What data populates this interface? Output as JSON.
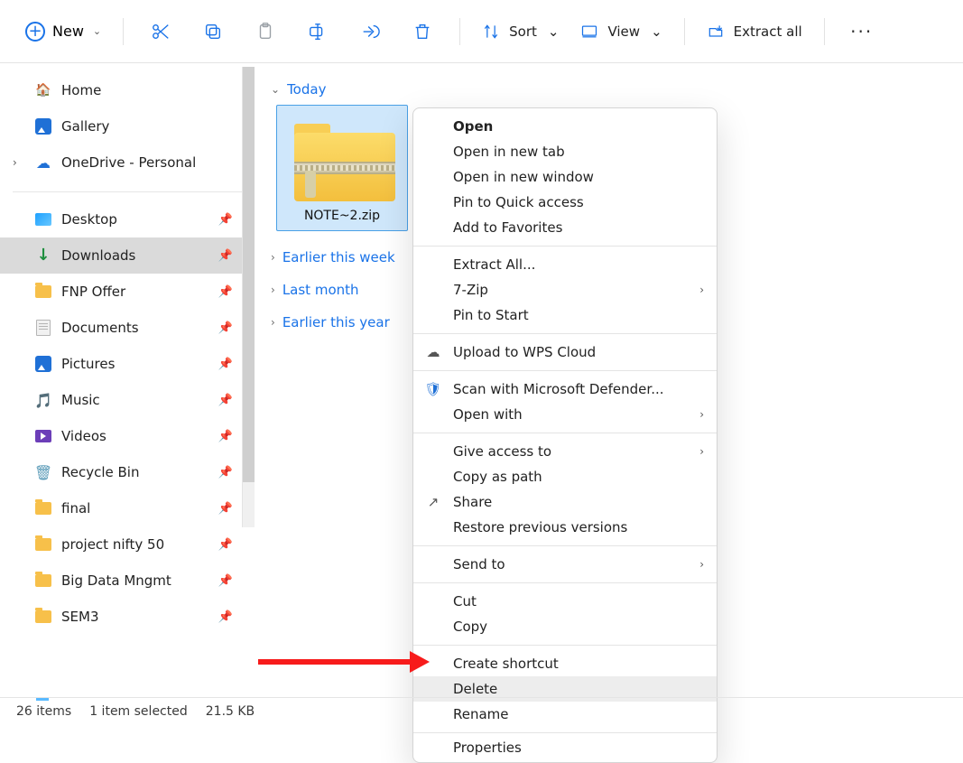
{
  "toolbar": {
    "new_label": "New",
    "sort_label": "Sort",
    "view_label": "View",
    "extract_label": "Extract all"
  },
  "sidebar": {
    "items": [
      {
        "label": "Home"
      },
      {
        "label": "Gallery"
      },
      {
        "label": "OneDrive - Personal"
      },
      {
        "label": "Desktop"
      },
      {
        "label": "Downloads"
      },
      {
        "label": "FNP Offer"
      },
      {
        "label": "Documents"
      },
      {
        "label": "Pictures"
      },
      {
        "label": "Music"
      },
      {
        "label": "Videos"
      },
      {
        "label": "Recycle Bin"
      },
      {
        "label": "final"
      },
      {
        "label": "project nifty 50"
      },
      {
        "label": "Big Data Mngmt"
      },
      {
        "label": "SEM3"
      }
    ]
  },
  "groups": {
    "today": "Today",
    "earlier_week": "Earlier this week",
    "last_month": "Last month",
    "earlier_year": "Earlier this year"
  },
  "file": {
    "name": "NOTE~2.zip"
  },
  "context_menu": {
    "open": "Open",
    "open_new_tab": "Open in new tab",
    "open_new_window": "Open in new window",
    "pin_quick": "Pin to Quick access",
    "add_favorites": "Add to Favorites",
    "extract_all": "Extract All...",
    "seven_zip": "7-Zip",
    "pin_start": "Pin to Start",
    "upload_wps": "Upload to WPS Cloud",
    "scan_defender": "Scan with Microsoft Defender...",
    "open_with": "Open with",
    "give_access": "Give access to",
    "copy_path": "Copy as path",
    "share": "Share",
    "restore_prev": "Restore previous versions",
    "send_to": "Send to",
    "cut": "Cut",
    "copy": "Copy",
    "create_shortcut": "Create shortcut",
    "delete": "Delete",
    "rename": "Rename",
    "properties": "Properties"
  },
  "status": {
    "count": "26 items",
    "selected": "1 item selected",
    "size": "21.5 KB"
  }
}
